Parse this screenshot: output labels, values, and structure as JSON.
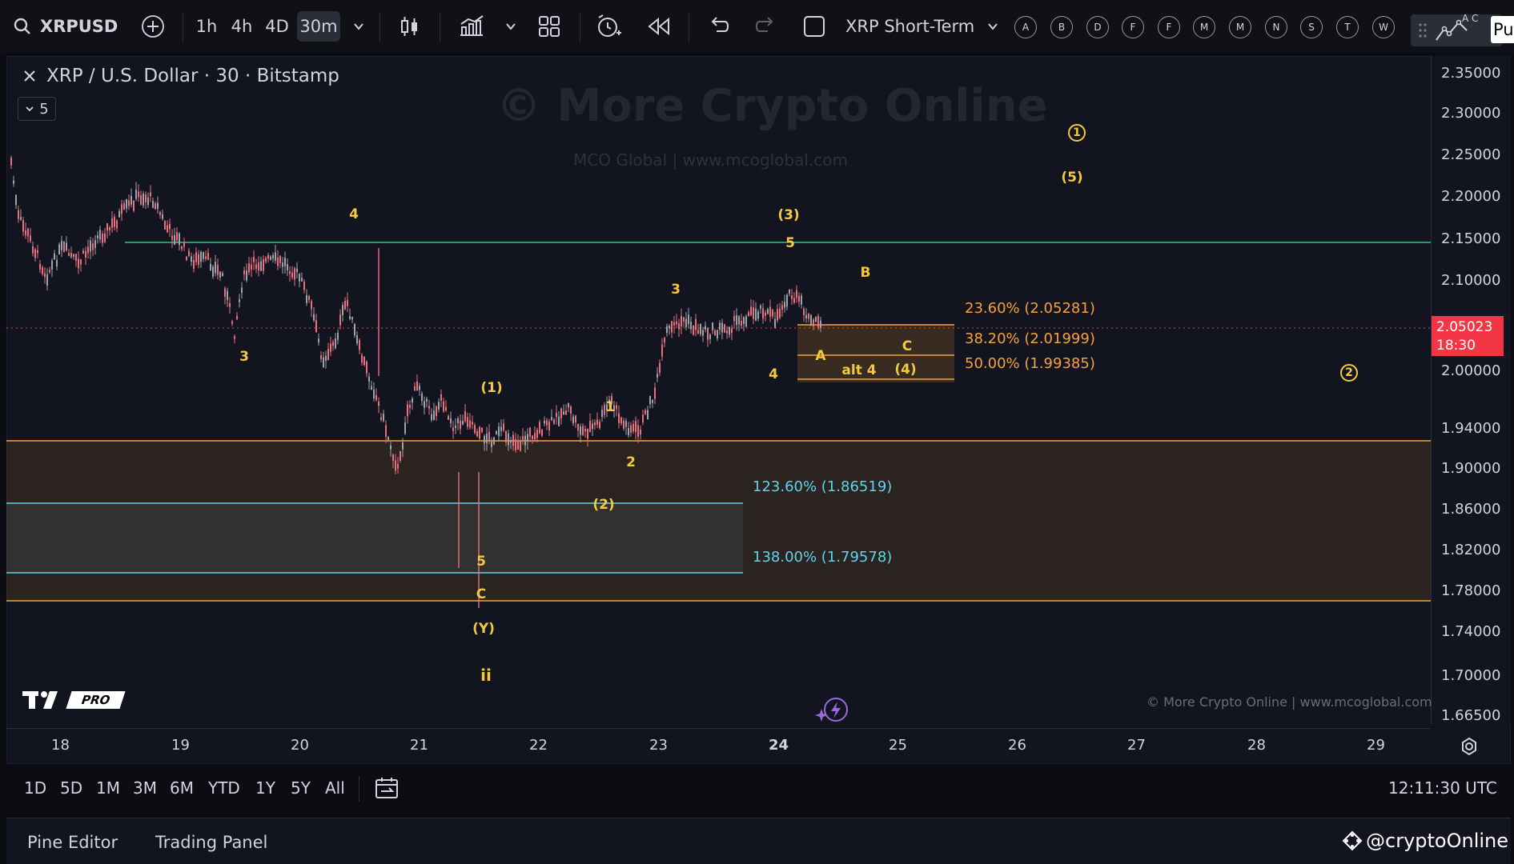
{
  "toolbar": {
    "symbol": "XRPUSD",
    "intervals": [
      "1h",
      "4h",
      "4D",
      "30m"
    ],
    "active_interval": "30m",
    "layout_name": "XRP Short-Term",
    "alert_letters": [
      "A",
      "B",
      "D",
      "F",
      "F",
      "M",
      "M",
      "N",
      "S",
      "T",
      "W"
    ],
    "publish_label": "Pu",
    "ac_label": "A C"
  },
  "legend": {
    "title": "XRP / U.S. Dollar · 30 · Bitstamp",
    "indicator_count": "5"
  },
  "watermark": {
    "main": "© More Crypto Online",
    "sub": "MCO Global   |   www.mcoglobal.com",
    "copyright": "© More Crypto Online   |   www.mcoglobal.com"
  },
  "price_axis": {
    "labels": [
      "2.35000",
      "2.30000",
      "2.25000",
      "2.20000",
      "2.15000",
      "2.10000",
      "2.00000",
      "1.94000",
      "1.90000",
      "1.86000",
      "1.82000",
      "1.78000",
      "1.74000",
      "1.70000",
      "1.66500"
    ],
    "current_price": "2.05023",
    "countdown": "18:30"
  },
  "time_axis": {
    "labels": [
      "18",
      "19",
      "20",
      "21",
      "22",
      "23",
      "24",
      "25",
      "26",
      "27",
      "28",
      "29"
    ]
  },
  "fib_levels": {
    "orange": [
      "23.60% (2.05281)",
      "38.20% (2.01999)",
      "50.00% (1.99385)"
    ],
    "cyan": [
      "123.60% (1.86519)",
      "138.00% (1.79578)"
    ]
  },
  "wave_labels": {
    "w4a": "4",
    "w3a": "3",
    "w1p": "(1)",
    "w5a": "5",
    "wC1": "C",
    "wY": "(Y)",
    "wii": "ii",
    "w2p": "(2)",
    "w1": "1",
    "w2": "2",
    "w3b": "3",
    "w3p": "(3)",
    "w5b": "5",
    "w4b": "4",
    "wA": "A",
    "wB": "B",
    "wC2": "C",
    "walt4": "alt 4",
    "w4p": "(4)",
    "w5p": "(5)",
    "wc1": "1",
    "wc2": "2"
  },
  "range_bar": {
    "ranges": [
      "1D",
      "5D",
      "1M",
      "3M",
      "6M",
      "YTD",
      "1Y",
      "5Y",
      "All"
    ],
    "clock": "12:11:30 UTC"
  },
  "bottom_tabs": {
    "pine_editor": "Pine Editor",
    "trading_panel": "Trading Panel",
    "handle": "@cryptoOnline"
  },
  "branding": {
    "pro": "PRO"
  },
  "colors": {
    "up": "#9fa3ab",
    "down": "#e8717d",
    "accent_orange": "#f7a13a",
    "accent_cyan": "#5fd4ec",
    "wave_yellow": "#f5c93e",
    "current_price_bg": "#f23645",
    "green_line": "#3fbf7f"
  }
}
